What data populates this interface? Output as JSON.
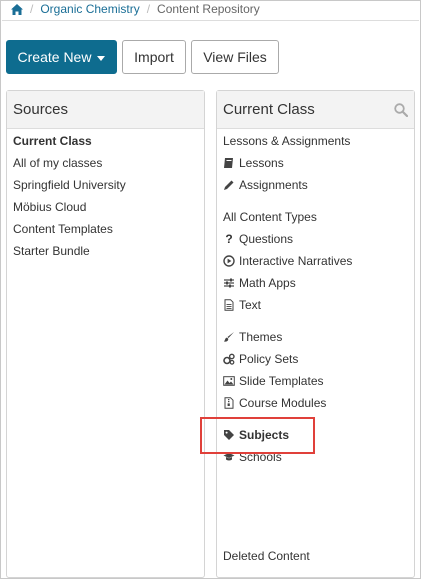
{
  "breadcrumb": {
    "home_icon": "home-icon",
    "items": [
      "Organic Chemistry",
      "Content Repository"
    ]
  },
  "toolbar": {
    "create_new_label": "Create New",
    "import_label": "Import",
    "view_files_label": "View Files",
    "primary_color": "#0e6c8f"
  },
  "sources": {
    "title": "Sources",
    "items": [
      "Current Class",
      "All of my classes",
      "Springfield University",
      "Möbius Cloud",
      "Content Templates",
      "Starter Bundle"
    ]
  },
  "current_class": {
    "title": "Current Class",
    "search_icon": "search-icon",
    "section_lessons": "Lessons & Assignments",
    "lessons": "Lessons",
    "assignments": "Assignments",
    "section_content_types": "All Content Types",
    "questions": "Questions",
    "interactive_narratives": "Interactive Narratives",
    "math_apps": "Math Apps",
    "text": "Text",
    "themes": "Themes",
    "policy_sets": "Policy Sets",
    "slide_templates": "Slide Templates",
    "course_modules": "Course Modules",
    "subjects": "Subjects",
    "schools": "Schools",
    "deleted_content": "Deleted Content",
    "highlight_color": "#e0403a"
  }
}
